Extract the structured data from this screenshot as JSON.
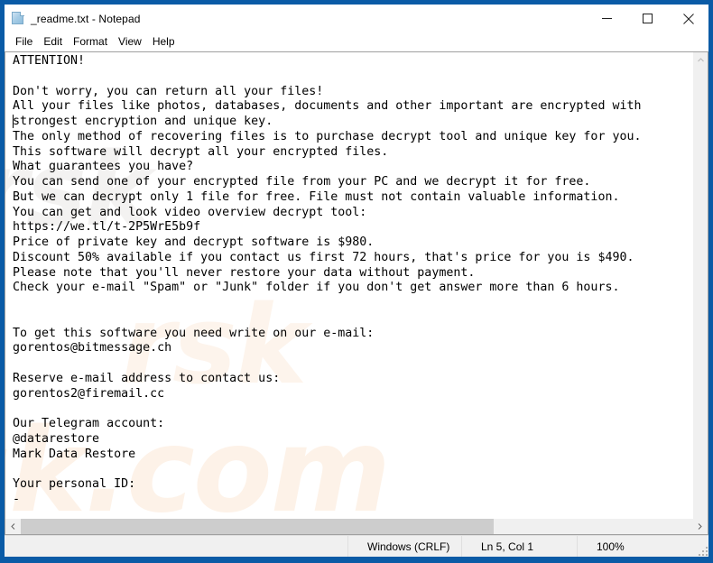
{
  "window": {
    "title": "_readme.txt - Notepad",
    "app_icon": "notepad-document-icon",
    "frame_color": "#0a5ba6",
    "controls": {
      "minimize": "minimize-icon",
      "maximize": "maximize-icon",
      "close": "close-icon"
    }
  },
  "menubar": {
    "items": [
      {
        "label": "File"
      },
      {
        "label": "Edit"
      },
      {
        "label": "Format"
      },
      {
        "label": "View"
      },
      {
        "label": "Help"
      }
    ]
  },
  "editor": {
    "text": "ATTENTION!\n\nDon't worry, you can return all your files!\nAll your files like photos, databases, documents and other important are encrypted with\nstrongest encryption and unique key.\nThe only method of recovering files is to purchase decrypt tool and unique key for you.\nThis software will decrypt all your encrypted files.\nWhat guarantees you have?\nYou can send one of your encrypted file from your PC and we decrypt it for free.\nBut we can decrypt only 1 file for free. File must not contain valuable information.\nYou can get and look video overview decrypt tool:\nhttps://we.tl/t-2P5WrE5b9f\nPrice of private key and decrypt software is $980.\nDiscount 50% available if you contact us first 72 hours, that's price for you is $490.\nPlease note that you'll never restore your data without payment.\nCheck your e-mail \"Spam\" or \"Junk\" folder if you don't get answer more than 6 hours.\n\n\nTo get this software you need write on our e-mail:\ngorentos@bitmessage.ch\n\nReserve e-mail address to contact us:\ngorentos2@firemail.cc\n\nOur Telegram account:\n@datarestore\nMark Data Restore\n\nYour personal ID:\n-",
    "watermark_1": "rsk",
    "watermark_2": "rsk",
    "watermark_3": "sk.com"
  },
  "scrollbars": {
    "vertical_up_arrow": "chevron-up-icon",
    "horizontal_left_arrow": "chevron-left-icon",
    "horizontal_right_arrow": "chevron-right-icon"
  },
  "statusbar": {
    "line_ending": "Windows (CRLF)",
    "cursor_position": "Ln 5, Col 1",
    "zoom": "100%"
  }
}
